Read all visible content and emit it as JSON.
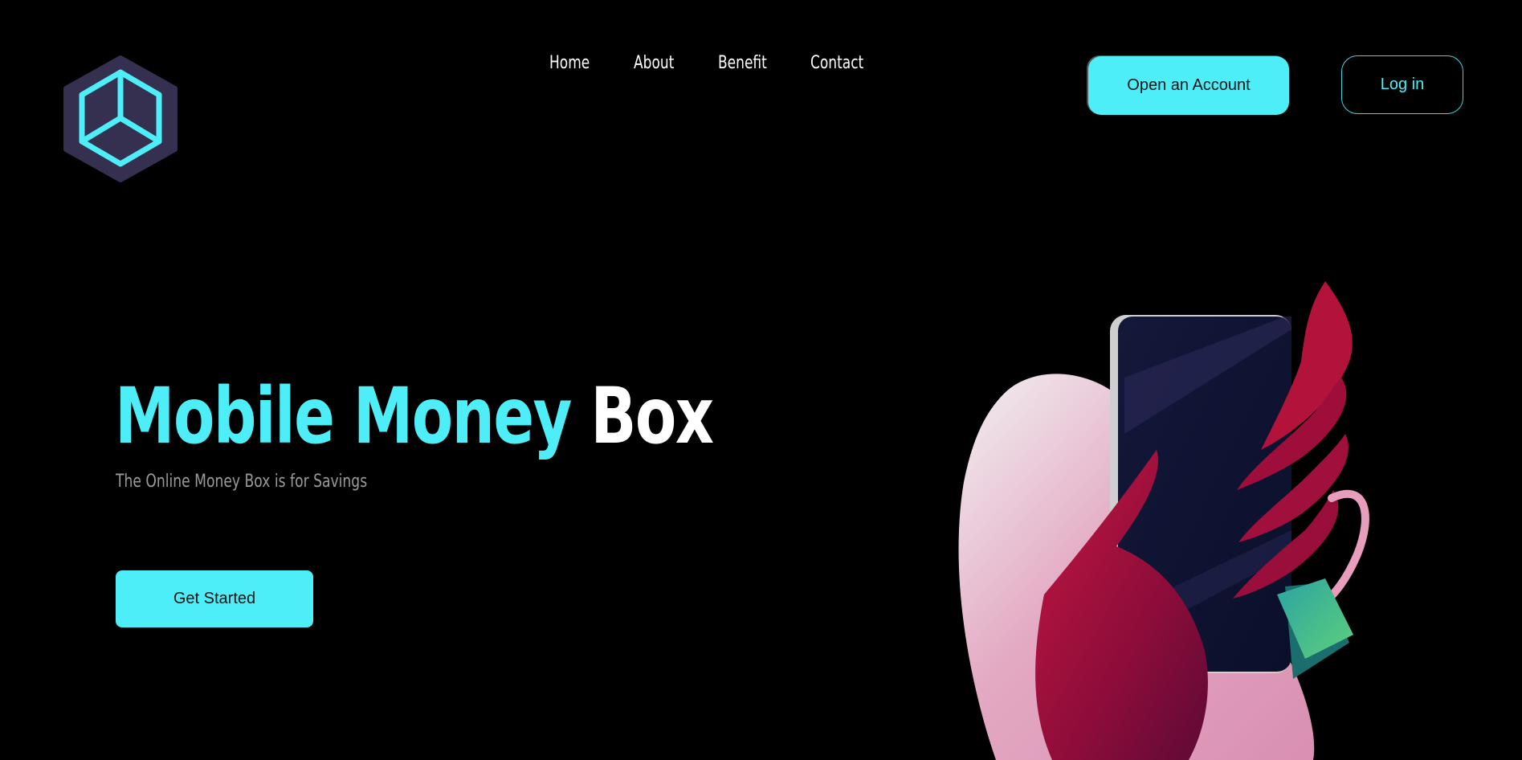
{
  "header": {
    "logo_icon": "cube-hexagon-logo",
    "nav": [
      {
        "label": "Home"
      },
      {
        "label": "About"
      },
      {
        "label": "Benefit"
      },
      {
        "label": "Contact"
      }
    ],
    "open_account_label": "Open an Account",
    "login_label": "Log in"
  },
  "hero": {
    "title_part1": "Mobile Money",
    "title_part2": "Box",
    "subtitle": "The Online Money Box is for Savings",
    "cta_label": "Get Started",
    "illustration": "hand-holding-phone-illustration"
  },
  "colors": {
    "background": "#000000",
    "accent": "#4deef8",
    "logo_hex": "#35304f",
    "subtitle": "#9a9a9a"
  }
}
